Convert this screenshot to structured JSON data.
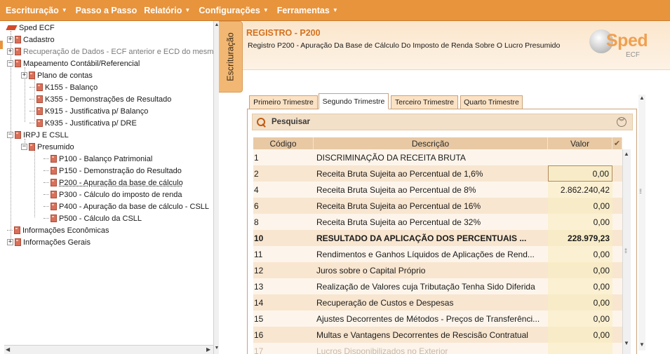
{
  "menu": {
    "items": [
      {
        "label": "Escrituração",
        "dropdown": true
      },
      {
        "label": "Passo a Passo",
        "dropdown": false
      },
      {
        "label": "Relatório",
        "dropdown": true
      },
      {
        "label": "Configurações",
        "dropdown": true
      },
      {
        "label": "Ferramentas",
        "dropdown": true
      }
    ]
  },
  "tree": {
    "items": [
      {
        "label": "Sped ECF",
        "expander": "",
        "dim": false
      },
      {
        "label": "Cadastro",
        "expander": "+",
        "dim": false
      },
      {
        "label": "Recuperação de Dados - ECF anterior e ECD do mesmo",
        "expander": "+",
        "dim": true
      },
      {
        "label": "Mapeamento Contábil/Referencial",
        "expander": "−",
        "dim": false
      },
      {
        "label": "Plano de contas",
        "expander": "+",
        "dim": false
      },
      {
        "label": "K155 - Balanço",
        "expander": "",
        "dim": false
      },
      {
        "label": "K355 - Demonstrações de Resultado",
        "expander": "",
        "dim": false
      },
      {
        "label": "K915 - Justificativa p/ Balanço",
        "expander": "",
        "dim": false
      },
      {
        "label": "K935 - Justificativa p/ DRE",
        "expander": "",
        "dim": false
      },
      {
        "label": "IRPJ E CSLL",
        "expander": "−",
        "dim": false
      },
      {
        "label": "Presumido",
        "expander": "−",
        "dim": false
      },
      {
        "label": "P100 - Balanço Patrimonial",
        "expander": "",
        "dim": false
      },
      {
        "label": "P150 - Demonstração do Resultado",
        "expander": "",
        "dim": false
      },
      {
        "label": "P200 - Apuração da base de cálculo",
        "expander": "",
        "dim": false,
        "selected": true
      },
      {
        "label": "P300 - Cálculo do imposto de renda",
        "expander": "",
        "dim": false
      },
      {
        "label": "P400 - Apuração da base de cálculo - CSLL",
        "expander": "",
        "dim": false
      },
      {
        "label": "P500 - Cálculo da CSLL",
        "expander": "",
        "dim": false
      },
      {
        "label": "Informações Econômicas",
        "expander": "",
        "dim": false
      },
      {
        "label": "Informações Gerais",
        "expander": "+",
        "dim": false
      }
    ]
  },
  "side_tab": {
    "label": "Escrituração"
  },
  "register": {
    "title": "REGISTRO - P200",
    "subtitle": "Registro P200 - Apuração Da Base de Cálculo Do Imposto de Renda Sobre O Lucro Presumido"
  },
  "logo": {
    "text": "Sped",
    "sub": "ECF"
  },
  "tabs": [
    {
      "label": "Primeiro Trimestre",
      "active": false
    },
    {
      "label": "Segundo Trimestre",
      "active": true
    },
    {
      "label": "Terceiro Trimestre",
      "active": false
    },
    {
      "label": "Quarto Trimestre",
      "active": false
    }
  ],
  "search": {
    "label": "Pesquisar"
  },
  "table": {
    "headers": {
      "code": "Código",
      "desc": "Descrição",
      "value": "Valor",
      "check": "✔"
    },
    "rows": [
      {
        "code": "1",
        "desc": "DISCRIMINAÇÃO DA RECEITA BRUTA",
        "value": "",
        "bold": false
      },
      {
        "code": "2",
        "desc": "Receita Bruta Sujeita ao Percentual de 1,6%",
        "value": "0,00",
        "bold": false,
        "focus": true
      },
      {
        "code": "4",
        "desc": "Receita Bruta Sujeita ao Percentual de 8%",
        "value": "2.862.240,42",
        "bold": false
      },
      {
        "code": "6",
        "desc": "Receita Bruta Sujeita ao Percentual de 16%",
        "value": "0,00",
        "bold": false
      },
      {
        "code": "8",
        "desc": "Receita Bruta Sujeita ao Percentual de 32%",
        "value": "0,00",
        "bold": false
      },
      {
        "code": "10",
        "desc": "RESULTADO DA APLICAÇÃO DOS PERCENTUAIS ...",
        "value": "228.979,23",
        "bold": true
      },
      {
        "code": "11",
        "desc": "Rendimentos e Ganhos Líquidos de Aplicações de Rend...",
        "value": "0,00",
        "bold": false
      },
      {
        "code": "12",
        "desc": "Juros sobre o Capital Próprio",
        "value": "0,00",
        "bold": false
      },
      {
        "code": "13",
        "desc": "Realização de Valores cuja Tributação Tenha Sido Diferida",
        "value": "0,00",
        "bold": false
      },
      {
        "code": "14",
        "desc": "Recuperação de Custos e Despesas",
        "value": "0,00",
        "bold": false
      },
      {
        "code": "15",
        "desc": "Ajustes Decorrentes de Métodos - Preços de Transferênci...",
        "value": "0,00",
        "bold": false
      },
      {
        "code": "16",
        "desc": "Multas e Vantagens Decorrentes de Rescisão Contratual",
        "value": "0,00",
        "bold": false
      },
      {
        "code": "17",
        "desc": "Lucros Disponibilizados no Exterior",
        "value": "",
        "bold": false,
        "faded": true
      }
    ]
  }
}
